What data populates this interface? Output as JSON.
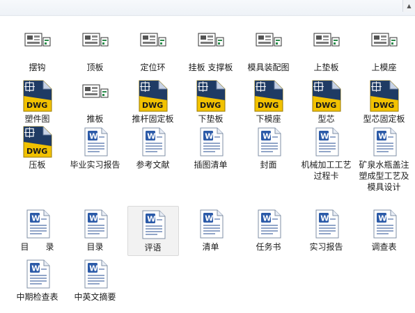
{
  "files": [
    {
      "label": "摆钩",
      "icon": "drawing-thumbnail"
    },
    {
      "label": "顶板",
      "icon": "drawing-thumbnail"
    },
    {
      "label": "定位环",
      "icon": "drawing-thumbnail"
    },
    {
      "label": "挂板 支撑板",
      "icon": "drawing-thumbnail"
    },
    {
      "label": "模具装配图",
      "icon": "drawing-thumbnail"
    },
    {
      "label": "上垫板",
      "icon": "drawing-thumbnail"
    },
    {
      "label": "上模座",
      "icon": "drawing-thumbnail"
    },
    {
      "label": "塑件图",
      "icon": "dwg-file"
    },
    {
      "label": "推板",
      "icon": "drawing-thumbnail"
    },
    {
      "label": "推杆固定板",
      "icon": "dwg-file"
    },
    {
      "label": "下垫板",
      "icon": "dwg-file"
    },
    {
      "label": "下模座",
      "icon": "dwg-file"
    },
    {
      "label": "型芯",
      "icon": "dwg-file"
    },
    {
      "label": "型芯固定板",
      "icon": "dwg-file"
    },
    {
      "label": "压板",
      "icon": "dwg-file"
    },
    {
      "label": "毕业实习报告",
      "icon": "word-doc"
    },
    {
      "label": "参考文献",
      "icon": "word-doc"
    },
    {
      "label": "插图清单",
      "icon": "word-doc"
    },
    {
      "label": "封面",
      "icon": "word-doc"
    },
    {
      "label": "机械加工工艺过程卡",
      "icon": "word-doc"
    },
    {
      "label": "矿泉水瓶盖注塑成型工艺及模具设计",
      "icon": "word-doc"
    },
    {
      "label": "目　　录",
      "icon": "word-doc"
    },
    {
      "label": "目录",
      "icon": "word-doc"
    },
    {
      "label": "评语",
      "icon": "word-doc",
      "selected": true
    },
    {
      "label": "清单",
      "icon": "word-doc"
    },
    {
      "label": "任务书",
      "icon": "word-doc"
    },
    {
      "label": "实习报告",
      "icon": "word-doc"
    },
    {
      "label": "调查表",
      "icon": "word-doc"
    },
    {
      "label": "中期检查表",
      "icon": "word-doc"
    },
    {
      "label": "中英文摘要",
      "icon": "word-doc"
    }
  ],
  "dwg_badge_text": "DWG",
  "colors": {
    "dwg_yellow": "#f2c200",
    "dwg_navy": "#1f3b64",
    "word_blue": "#2b5aa8",
    "selection_bg": "#f2f2f2"
  }
}
